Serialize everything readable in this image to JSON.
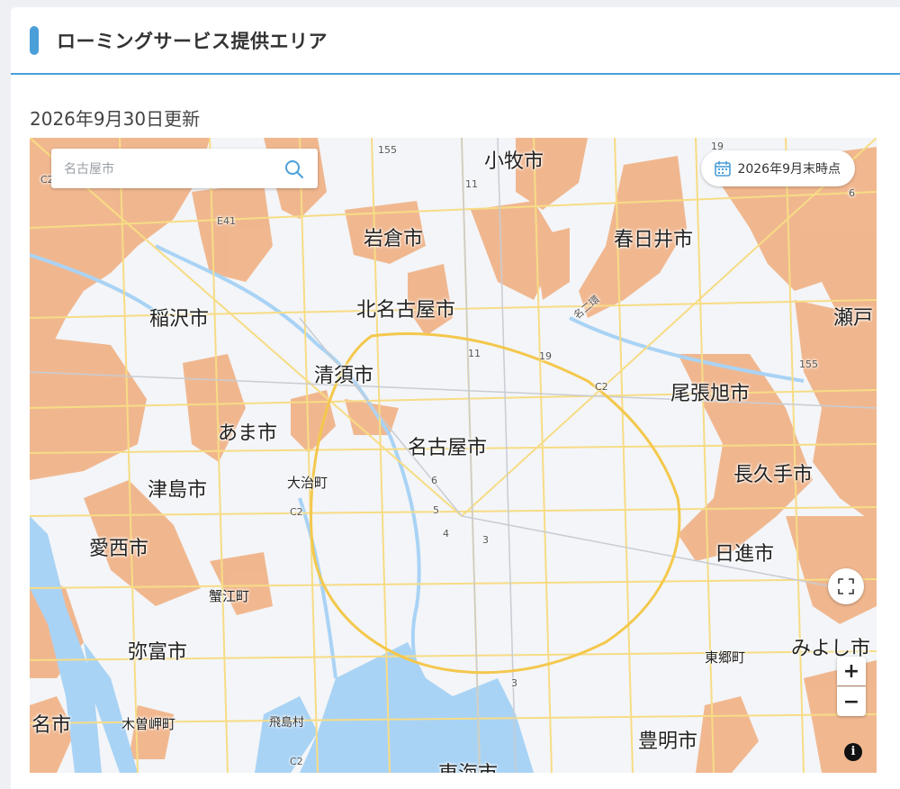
{
  "header": {
    "title": "ローミングサービス提供エリア"
  },
  "updated": "2026年9月30日更新",
  "search": {
    "placeholder": "名古屋市"
  },
  "date_chip": {
    "label": "2026年9月末時点"
  },
  "colors": {
    "accent": "#4a9fd8",
    "coverage": "#f0b48a",
    "water": "#a9d3f5",
    "road": "#f7dc85"
  },
  "map_labels": {
    "komaki": "小牧市",
    "iwakura": "岩倉市",
    "kasugai": "春日井市",
    "inazawa": "稲沢市",
    "kitanagoya": "北名古屋市",
    "seto": "瀬戸",
    "kiyosu": "清須市",
    "owariasahi": "尾張旭市",
    "ama": "あま市",
    "nagoya": "名古屋市",
    "nagakute": "長久手市",
    "oharu": "大治町",
    "tsushima": "津島市",
    "aisai": "愛西市",
    "nisshin": "日進市",
    "kanie": "蟹江町",
    "yatomi": "弥富市",
    "miyoshi": "みよし市",
    "togo": "東郷町",
    "kuwana": "名市",
    "kisosaki": "木曽岬町",
    "tobishima": "飛島村",
    "toyoake": "豊明市",
    "tokai": "東海市"
  },
  "road_markers": [
    "155",
    "E41",
    "19",
    "11",
    "11",
    "19",
    "C2",
    "155",
    "C2",
    "6",
    "5",
    "4",
    "3",
    "3",
    "C2",
    "C2",
    "名二環",
    "6"
  ],
  "controls": {
    "zoom_in": "+",
    "zoom_out": "−",
    "info": "i"
  }
}
